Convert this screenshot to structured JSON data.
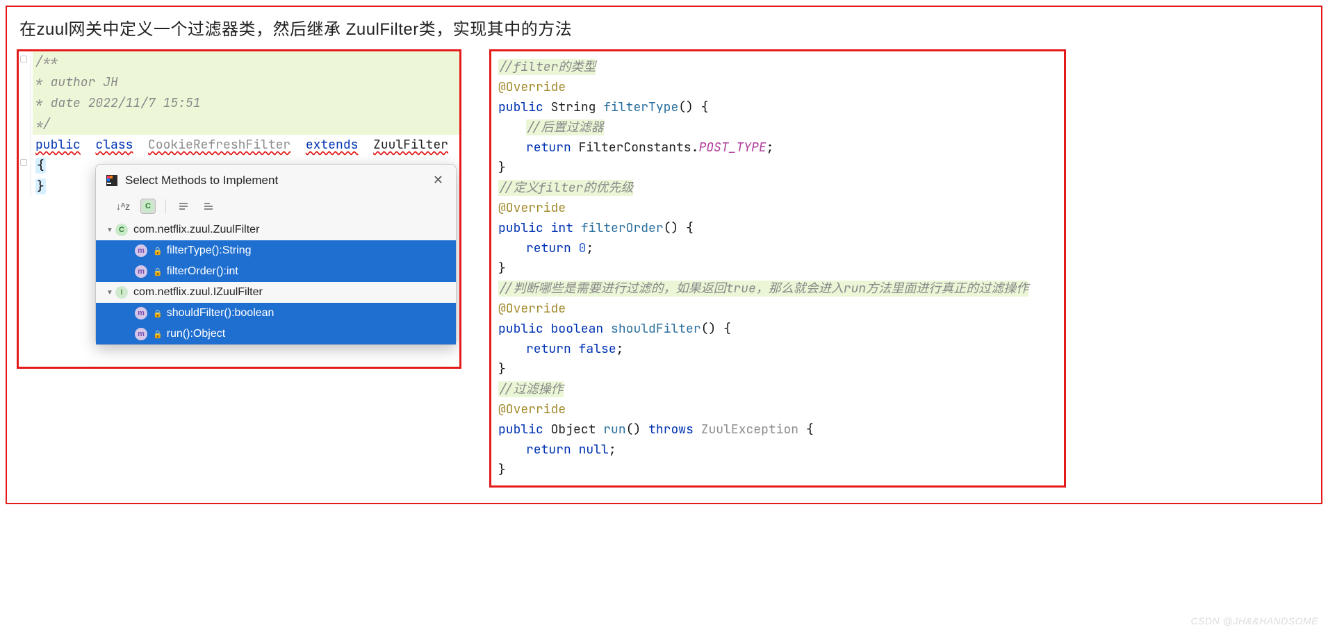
{
  "heading": "在zuul网关中定义一个过滤器类，然后继承 ZuulFilter类，实现其中的方法",
  "left": {
    "javadoc": {
      "open": "/**",
      "author": " * author JH",
      "date": " * date 2022/11/7 15:51",
      "close": " */"
    },
    "decl": {
      "kw_public": "public",
      "kw_class": "class",
      "name": "CookieRefreshFilter",
      "kw_extends": "extends",
      "parent": "ZuulFilter",
      "brace_open": "{",
      "brace_close": "}"
    }
  },
  "dialog": {
    "title": "Select Methods to Implement",
    "close": "✕",
    "toolbar": {
      "sort": "↓ᴬz",
      "class": "C",
      "expand": "⇄",
      "collapse": "⇉"
    },
    "tree": {
      "p1": "com.netflix.zuul.ZuulFilter",
      "p1_badge": "C",
      "m1": "filterType():String",
      "m2": "filterOrder():int",
      "p2": "com.netflix.zuul.IZuulFilter",
      "p2_badge": "I",
      "m3": "shouldFilter():boolean",
      "m4": "run():Object",
      "m_badge": "m"
    }
  },
  "right": {
    "c_type": "//filter的类型",
    "ann": "@Override",
    "kw_public": "public",
    "kw_int": "int",
    "kw_boolean": "boolean",
    "kw_return": "return",
    "kw_throws": "throws",
    "kw_false": "false",
    "kw_null": "null",
    "t_string": "String",
    "t_object": "Object",
    "fn_filterType": "filterType",
    "c_post": "//后置过滤器",
    "const_ref": "FilterConstants",
    "const_post": "POST_TYPE",
    "c_order": "//定义filter的优先级",
    "fn_filterOrder": "filterOrder",
    "ret_zero": "0",
    "c_should": "//判断哪些是需要进行过滤的，如果返回true，那么就会进入run方法里面进行真正的过滤操作",
    "fn_shouldFilter": "shouldFilter",
    "c_run": "//过滤操作",
    "fn_run": "run",
    "exc": "ZuulException",
    "lparen": "()",
    "brace_o": "{",
    "brace_c": "}",
    "semi": ";",
    "dot": "."
  },
  "watermark": "CSDN @JH&&HANDSOME"
}
